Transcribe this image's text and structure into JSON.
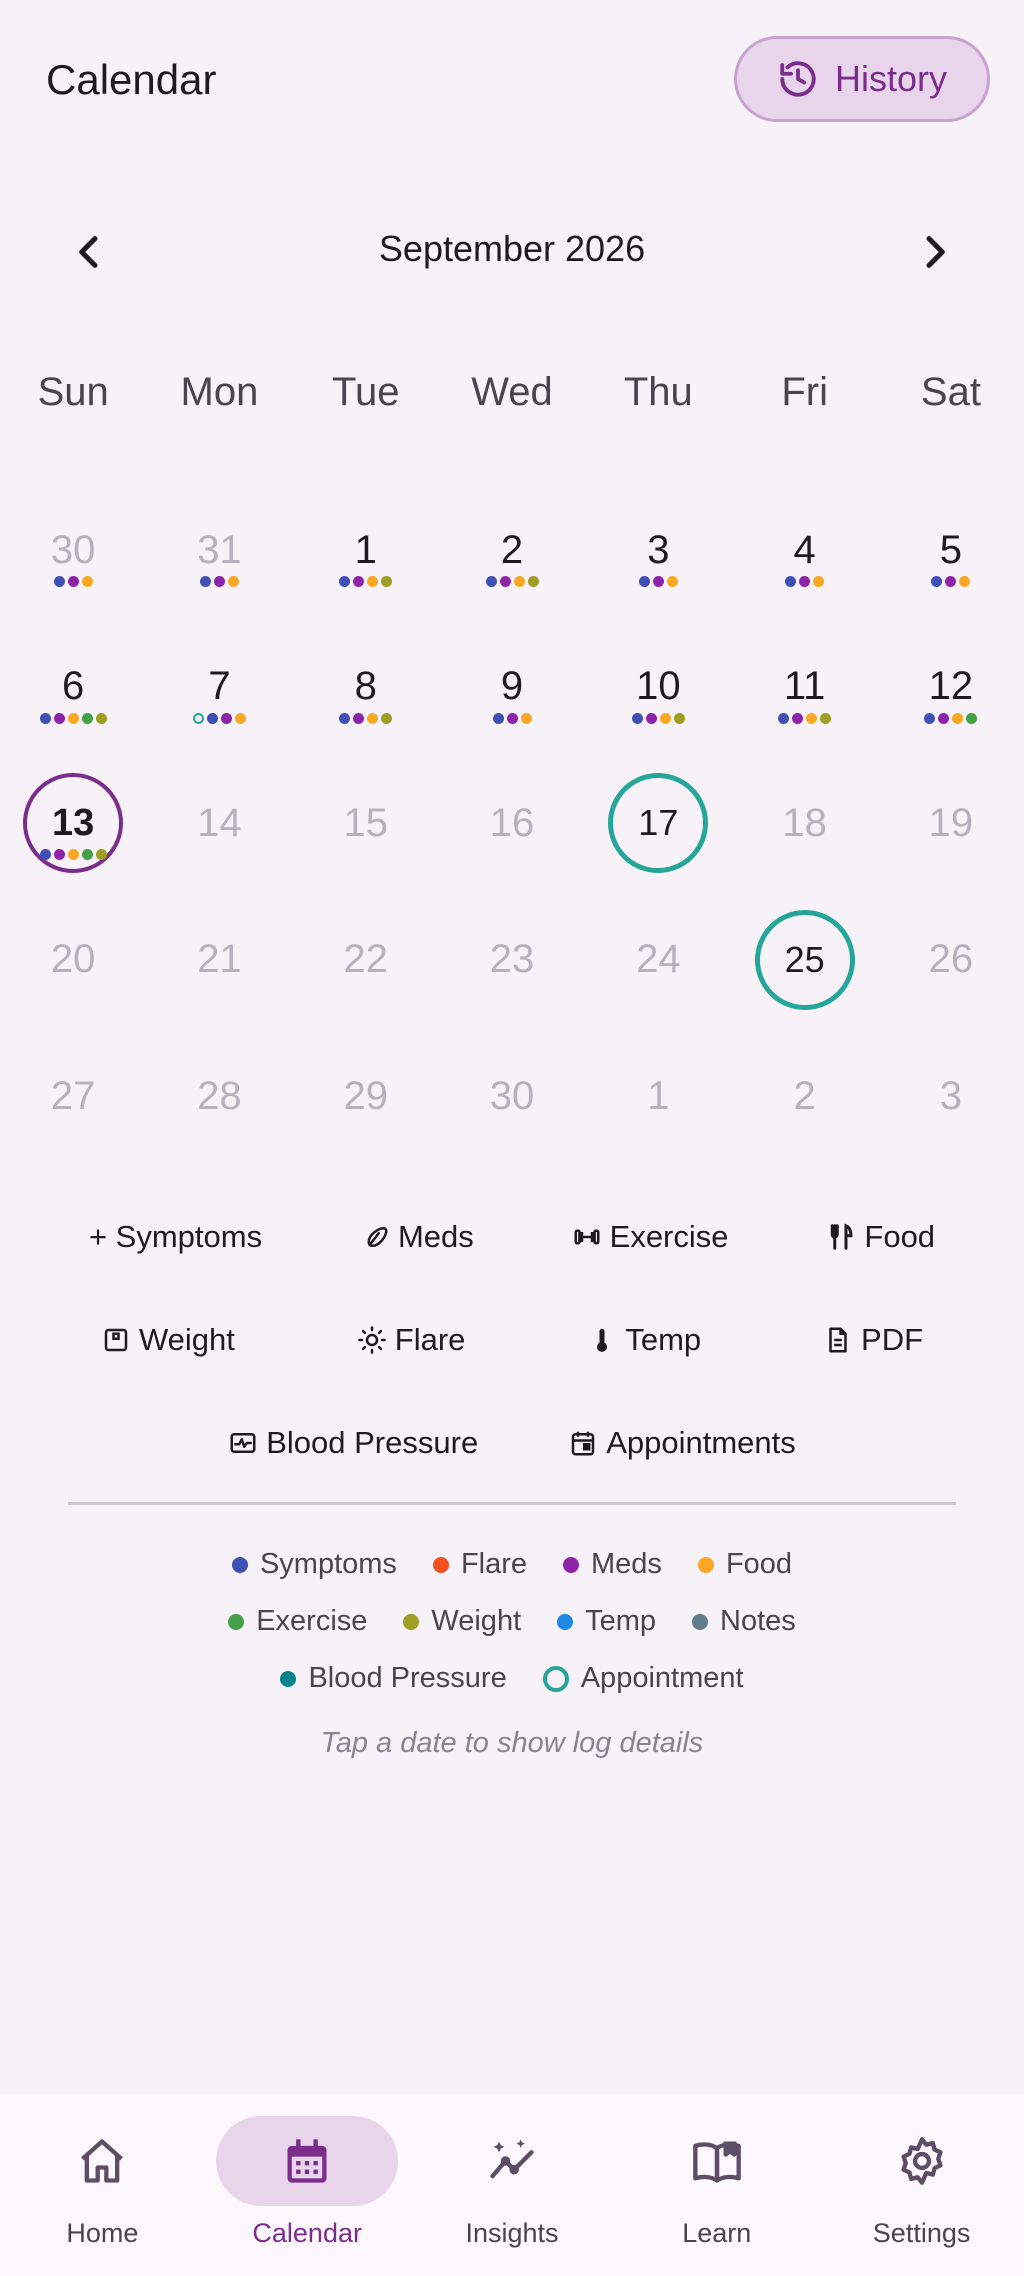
{
  "header": {
    "title": "Calendar",
    "history_label": "History"
  },
  "month_nav": {
    "label": "September 2026"
  },
  "weekdays": [
    "Sun",
    "Mon",
    "Tue",
    "Wed",
    "Thu",
    "Fri",
    "Sat"
  ],
  "colors": {
    "symptoms": "#3f51b5",
    "flare": "#f4511e",
    "meds": "#8e24aa",
    "food": "#f9a825",
    "exercise": "#43a047",
    "weight": "#9e9d24",
    "temp": "#1e88e5",
    "notes": "#607d8b",
    "blood_pressure": "#00838f",
    "appointment": "#26a69a",
    "selected": "#7b2d8b"
  },
  "days": [
    {
      "n": "30",
      "muted": true,
      "dots": [
        "symptoms",
        "meds",
        "food"
      ]
    },
    {
      "n": "31",
      "muted": true,
      "dots": [
        "symptoms",
        "meds",
        "food"
      ]
    },
    {
      "n": "1",
      "dots": [
        "symptoms",
        "meds",
        "food",
        "weight"
      ]
    },
    {
      "n": "2",
      "dots": [
        "symptoms",
        "meds",
        "food",
        "weight"
      ]
    },
    {
      "n": "3",
      "dots": [
        "symptoms",
        "meds",
        "food"
      ]
    },
    {
      "n": "4",
      "dots": [
        "symptoms",
        "meds",
        "food"
      ]
    },
    {
      "n": "5",
      "dots": [
        "symptoms",
        "meds",
        "food"
      ]
    },
    {
      "n": "6",
      "dots": [
        "symptoms",
        "meds",
        "food",
        "exercise",
        "weight"
      ]
    },
    {
      "n": "7",
      "dots": [
        "appointment",
        "symptoms",
        "meds",
        "food"
      ]
    },
    {
      "n": "8",
      "dots": [
        "symptoms",
        "meds",
        "food",
        "weight"
      ]
    },
    {
      "n": "9",
      "dots": [
        "symptoms",
        "meds",
        "food"
      ]
    },
    {
      "n": "10",
      "dots": [
        "symptoms",
        "meds",
        "food",
        "weight"
      ]
    },
    {
      "n": "11",
      "dots": [
        "symptoms",
        "meds",
        "food",
        "weight"
      ]
    },
    {
      "n": "12",
      "dots": [
        "symptoms",
        "meds",
        "food",
        "exercise"
      ]
    },
    {
      "n": "13",
      "selected": true,
      "dots": [
        "symptoms",
        "meds",
        "food",
        "exercise",
        "weight"
      ]
    },
    {
      "n": "14",
      "muted": true,
      "dots": []
    },
    {
      "n": "15",
      "muted": true,
      "dots": []
    },
    {
      "n": "16",
      "muted": true,
      "dots": []
    },
    {
      "n": "17",
      "appt": true,
      "dots": []
    },
    {
      "n": "18",
      "muted": true,
      "dots": []
    },
    {
      "n": "19",
      "muted": true,
      "dots": []
    },
    {
      "n": "20",
      "muted": true,
      "dots": []
    },
    {
      "n": "21",
      "muted": true,
      "dots": []
    },
    {
      "n": "22",
      "muted": true,
      "dots": []
    },
    {
      "n": "23",
      "muted": true,
      "dots": []
    },
    {
      "n": "24",
      "muted": true,
      "dots": []
    },
    {
      "n": "25",
      "appt": true,
      "dots": []
    },
    {
      "n": "26",
      "muted": true,
      "dots": []
    },
    {
      "n": "27",
      "muted": true,
      "dots": []
    },
    {
      "n": "28",
      "muted": true,
      "dots": []
    },
    {
      "n": "29",
      "muted": true,
      "dots": []
    },
    {
      "n": "30",
      "muted": true,
      "dots": []
    },
    {
      "n": "1",
      "muted": true,
      "dots": []
    },
    {
      "n": "2",
      "muted": true,
      "dots": []
    },
    {
      "n": "3",
      "muted": true,
      "dots": []
    }
  ],
  "quick_actions": {
    "symptoms": "+ Symptoms",
    "meds": "Meds",
    "exercise": "Exercise",
    "food": "Food",
    "weight": "Weight",
    "flare": "Flare",
    "temp": "Temp",
    "pdf": "PDF",
    "blood_pressure": "Blood Pressure",
    "appointments": "Appointments"
  },
  "legend": {
    "symptoms": "Symptoms",
    "flare": "Flare",
    "meds": "Meds",
    "food": "Food",
    "exercise": "Exercise",
    "weight": "Weight",
    "temp": "Temp",
    "notes": "Notes",
    "blood_pressure": "Blood Pressure",
    "appointment": "Appointment"
  },
  "hint": "Tap a date to show log details",
  "bottom_nav": {
    "home": "Home",
    "calendar": "Calendar",
    "insights": "Insights",
    "learn": "Learn",
    "settings": "Settings"
  }
}
